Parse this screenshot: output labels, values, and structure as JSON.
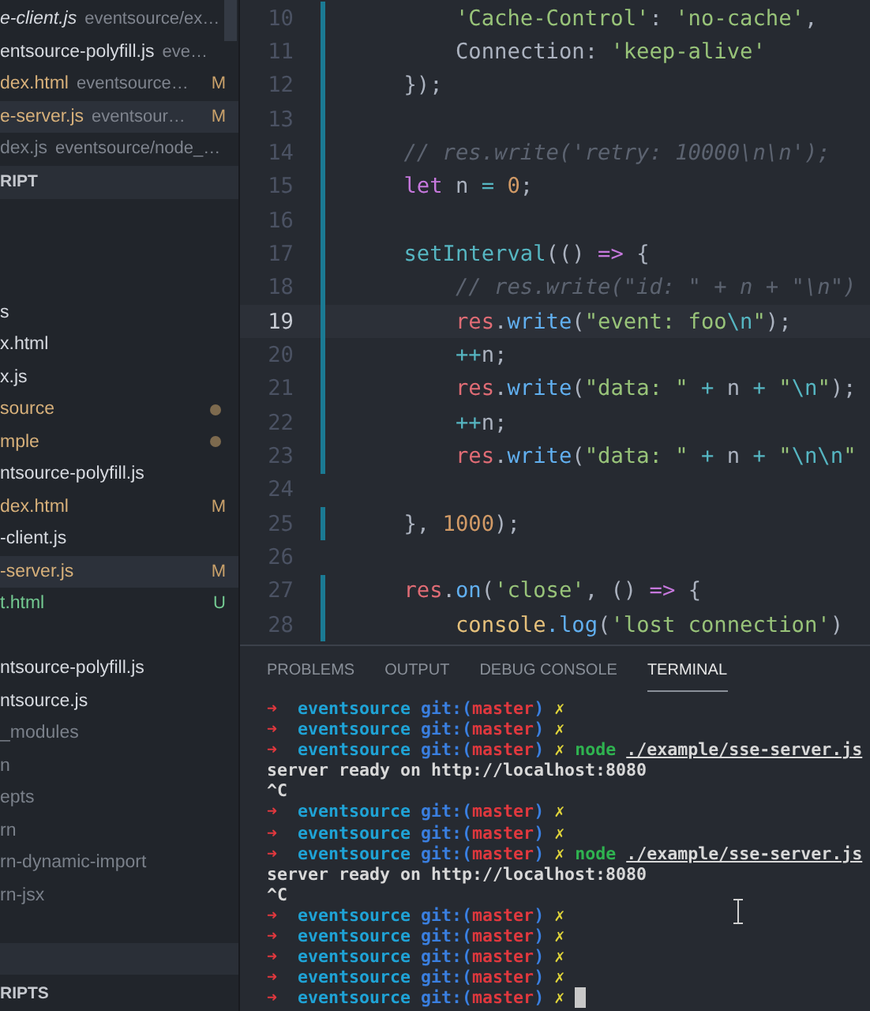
{
  "sidebar": {
    "open_editors": [
      {
        "name": "e-client.js",
        "path": "eventsource/ex…",
        "kind": "normal",
        "preview": true,
        "selected": false
      },
      {
        "name": "entsource-polyfill.js",
        "path": "eve…",
        "kind": "normal",
        "preview": false,
        "selected": false
      },
      {
        "name": "dex.html",
        "path": "eventsource…",
        "kind": "modified",
        "badge": "M",
        "preview": false,
        "selected": false
      },
      {
        "name": "e-server.js",
        "path": "eventsour…",
        "kind": "modified",
        "badge": "M",
        "preview": false,
        "selected": true
      },
      {
        "name": "dex.js",
        "path": "eventsource/node_…",
        "kind": "ignored",
        "preview": false,
        "selected": false
      }
    ],
    "section_header": "RIPT",
    "tree": [
      {
        "name": "s",
        "kind": "normal",
        "dot": false,
        "selected": false
      },
      {
        "name": "x.html",
        "kind": "normal",
        "dot": false,
        "selected": false
      },
      {
        "name": "x.js",
        "kind": "normal",
        "dot": false,
        "selected": false
      },
      {
        "name": "source",
        "kind": "modified",
        "dot": true,
        "selected": false
      },
      {
        "name": "mple",
        "kind": "modified",
        "dot": true,
        "selected": false
      },
      {
        "name": "ntsource-polyfill.js",
        "kind": "normal",
        "dot": false,
        "selected": false
      },
      {
        "name": "dex.html",
        "kind": "modified",
        "badge": "M",
        "dot": false,
        "selected": false
      },
      {
        "name": "-client.js",
        "kind": "normal",
        "dot": false,
        "selected": false
      },
      {
        "name": "-server.js",
        "kind": "modified",
        "badge": "M",
        "dot": false,
        "selected": true
      },
      {
        "name": "t.html",
        "kind": "untracked",
        "badge": "U",
        "dot": false,
        "selected": false
      }
    ],
    "tree_2": [
      {
        "name": "ntsource-polyfill.js",
        "kind": "normal",
        "dot": false,
        "selected": false
      },
      {
        "name": "ntsource.js",
        "kind": "normal",
        "dot": false,
        "selected": false
      },
      {
        "name": "_modules",
        "kind": "ignored",
        "dot": false,
        "selected": false
      },
      {
        "name": "n",
        "kind": "ignored",
        "dot": false,
        "selected": false
      },
      {
        "name": "epts",
        "kind": "ignored",
        "dot": false,
        "selected": false
      },
      {
        "name": "rn",
        "kind": "ignored",
        "dot": false,
        "selected": false
      },
      {
        "name": "rn-dynamic-import",
        "kind": "ignored",
        "dot": false,
        "selected": false
      },
      {
        "name": "rn-jsx",
        "kind": "ignored",
        "dot": false,
        "selected": false
      }
    ],
    "bottom_section_header": "RIPTS"
  },
  "editor": {
    "lines": [
      {
        "number": "10",
        "changed": true,
        "current": false,
        "tokens": [
          {
            "text": "        'Cache-Control'",
            "kind": "str"
          },
          {
            "text": ": ",
            "kind": "plain"
          },
          {
            "text": "'no-cache'",
            "kind": "str"
          },
          {
            "text": ",",
            "kind": "plain"
          }
        ]
      },
      {
        "number": "11",
        "changed": true,
        "current": false,
        "tokens": [
          {
            "text": "        Connection: ",
            "kind": "plain"
          },
          {
            "text": "'keep-alive'",
            "kind": "str"
          }
        ]
      },
      {
        "number": "12",
        "changed": true,
        "current": false,
        "tokens": [
          {
            "text": "    });",
            "kind": "plain"
          }
        ]
      },
      {
        "number": "13",
        "changed": true,
        "current": false
      },
      {
        "number": "14",
        "changed": true,
        "current": false,
        "tokens": [
          {
            "text": "    // res.write('retry: 10000\\n\\n');",
            "kind": "comment"
          }
        ]
      },
      {
        "number": "15",
        "changed": true,
        "current": false,
        "tokens": [
          {
            "text": "    let",
            "kind": "kw"
          },
          {
            "text": " n ",
            "kind": "plain"
          },
          {
            "text": "=",
            "kind": "op"
          },
          {
            "text": " 0",
            "kind": "num"
          },
          {
            "text": ";",
            "kind": "plain"
          }
        ]
      },
      {
        "number": "16",
        "changed": true,
        "current": false
      },
      {
        "number": "17",
        "changed": true,
        "current": false,
        "tokens": [
          {
            "text": "    setInterval",
            "kind": "call"
          },
          {
            "text": "(() ",
            "kind": "plain"
          },
          {
            "text": "=>",
            "kind": "kw"
          },
          {
            "text": " {",
            "kind": "plain"
          }
        ]
      },
      {
        "number": "18",
        "changed": true,
        "current": false,
        "tokens": [
          {
            "text": "        // res.write(\"id: \" + n + \"\\n\")",
            "kind": "comment"
          }
        ]
      },
      {
        "number": "19",
        "changed": true,
        "current": true,
        "tokens": [
          {
            "text": "        res",
            "kind": "var"
          },
          {
            "text": ".",
            "kind": "plain"
          },
          {
            "text": "write",
            "kind": "fn"
          },
          {
            "text": "(",
            "kind": "plain"
          },
          {
            "text": "\"event: foo",
            "kind": "str"
          },
          {
            "text": "\\n",
            "kind": "esc"
          },
          {
            "text": "\"",
            "kind": "str"
          },
          {
            "text": ");",
            "kind": "plain"
          }
        ]
      },
      {
        "number": "20",
        "changed": true,
        "current": false,
        "tokens": [
          {
            "text": "        ++",
            "kind": "op"
          },
          {
            "text": "n;",
            "kind": "plain"
          }
        ]
      },
      {
        "number": "21",
        "changed": true,
        "current": false,
        "tokens": [
          {
            "text": "        res",
            "kind": "var"
          },
          {
            "text": ".",
            "kind": "plain"
          },
          {
            "text": "write",
            "kind": "fn"
          },
          {
            "text": "(",
            "kind": "plain"
          },
          {
            "text": "\"data: \"",
            "kind": "str"
          },
          {
            "text": " + ",
            "kind": "op"
          },
          {
            "text": "n",
            "kind": "plain"
          },
          {
            "text": " + ",
            "kind": "op"
          },
          {
            "text": "\"",
            "kind": "str"
          },
          {
            "text": "\\n",
            "kind": "esc"
          },
          {
            "text": "\"",
            "kind": "str"
          },
          {
            "text": ");",
            "kind": "plain"
          }
        ]
      },
      {
        "number": "22",
        "changed": true,
        "current": false,
        "tokens": [
          {
            "text": "        ++",
            "kind": "op"
          },
          {
            "text": "n;",
            "kind": "plain"
          }
        ]
      },
      {
        "number": "23",
        "changed": true,
        "current": false,
        "tokens": [
          {
            "text": "        res",
            "kind": "var"
          },
          {
            "text": ".",
            "kind": "plain"
          },
          {
            "text": "write",
            "kind": "fn"
          },
          {
            "text": "(",
            "kind": "plain"
          },
          {
            "text": "\"data: \"",
            "kind": "str"
          },
          {
            "text": " + ",
            "kind": "op"
          },
          {
            "text": "n",
            "kind": "plain"
          },
          {
            "text": " + ",
            "kind": "op"
          },
          {
            "text": "\"",
            "kind": "str"
          },
          {
            "text": "\\n\\n",
            "kind": "esc"
          },
          {
            "text": "\"",
            "kind": "str"
          }
        ]
      },
      {
        "number": "24",
        "changed": false,
        "current": false
      },
      {
        "number": "25",
        "changed": true,
        "current": false,
        "tokens": [
          {
            "text": "    }, ",
            "kind": "plain"
          },
          {
            "text": "1000",
            "kind": "num"
          },
          {
            "text": ");",
            "kind": "plain"
          }
        ]
      },
      {
        "number": "26",
        "changed": false,
        "current": false
      },
      {
        "number": "27",
        "changed": true,
        "current": false,
        "tokens": [
          {
            "text": "    res",
            "kind": "var"
          },
          {
            "text": ".",
            "kind": "plain"
          },
          {
            "text": "on",
            "kind": "fn"
          },
          {
            "text": "(",
            "kind": "plain"
          },
          {
            "text": "'close'",
            "kind": "str"
          },
          {
            "text": ", () ",
            "kind": "plain"
          },
          {
            "text": "=>",
            "kind": "kw"
          },
          {
            "text": " {",
            "kind": "plain"
          }
        ]
      },
      {
        "number": "28",
        "changed": true,
        "current": false,
        "tokens": [
          {
            "text": "        console",
            "kind": "class"
          },
          {
            "text": ".log",
            "kind": "fn"
          },
          {
            "text": "(",
            "kind": "plain"
          },
          {
            "text": "'lost connection'",
            "kind": "str"
          },
          {
            "text": ")",
            "kind": "plain"
          }
        ]
      }
    ]
  },
  "panel": {
    "tabs": [
      {
        "label": "PROBLEMS",
        "selected": false
      },
      {
        "label": "OUTPUT",
        "selected": false
      },
      {
        "label": "DEBUG CONSOLE",
        "selected": false
      },
      {
        "label": "TERMINAL",
        "selected": true
      }
    ],
    "terminal": [
      {
        "cursor": false,
        "segments": [
          {
            "text": "➜",
            "kind": "arrow"
          },
          {
            "text": "  eventsource",
            "kind": "dir"
          },
          {
            "text": " git:(",
            "kind": "git"
          },
          {
            "text": "master",
            "kind": "branch"
          },
          {
            "text": ")",
            "kind": "git"
          },
          {
            "text": " ✗",
            "kind": "dirty"
          }
        ]
      },
      {
        "cursor": false,
        "segments": [
          {
            "text": "➜",
            "kind": "arrow"
          },
          {
            "text": "  eventsource",
            "kind": "dir"
          },
          {
            "text": " git:(",
            "kind": "git"
          },
          {
            "text": "master",
            "kind": "branch"
          },
          {
            "text": ")",
            "kind": "git"
          },
          {
            "text": " ✗",
            "kind": "dirty"
          }
        ]
      },
      {
        "cursor": false,
        "segments": [
          {
            "text": "➜",
            "kind": "arrow"
          },
          {
            "text": "  eventsource",
            "kind": "dir"
          },
          {
            "text": " git:(",
            "kind": "git"
          },
          {
            "text": "master",
            "kind": "branch"
          },
          {
            "text": ")",
            "kind": "git"
          },
          {
            "text": " ✗",
            "kind": "dirty"
          },
          {
            "text": " node ",
            "kind": "cmd"
          },
          {
            "text": "./example/sse-server.js",
            "kind": "arg"
          }
        ]
      },
      {
        "cursor": false,
        "segments": [
          {
            "text": "server ready on http://localhost:8080",
            "kind": "out"
          }
        ]
      },
      {
        "cursor": false,
        "segments": [
          {
            "text": "^C",
            "kind": "out"
          }
        ]
      },
      {
        "cursor": false,
        "segments": [
          {
            "text": "➜",
            "kind": "arrow"
          },
          {
            "text": "  eventsource",
            "kind": "dir"
          },
          {
            "text": " git:(",
            "kind": "git"
          },
          {
            "text": "master",
            "kind": "branch"
          },
          {
            "text": ")",
            "kind": "git"
          },
          {
            "text": " ✗",
            "kind": "dirty"
          }
        ]
      },
      {
        "cursor": false,
        "segments": [
          {
            "text": "➜",
            "kind": "arrow"
          },
          {
            "text": "  eventsource",
            "kind": "dir"
          },
          {
            "text": " git:(",
            "kind": "git"
          },
          {
            "text": "master",
            "kind": "branch"
          },
          {
            "text": ")",
            "kind": "git"
          },
          {
            "text": " ✗",
            "kind": "dirty"
          }
        ]
      },
      {
        "cursor": false,
        "segments": [
          {
            "text": "➜",
            "kind": "arrow"
          },
          {
            "text": "  eventsource",
            "kind": "dir"
          },
          {
            "text": " git:(",
            "kind": "git"
          },
          {
            "text": "master",
            "kind": "branch"
          },
          {
            "text": ")",
            "kind": "git"
          },
          {
            "text": " ✗",
            "kind": "dirty"
          },
          {
            "text": " node ",
            "kind": "cmd"
          },
          {
            "text": "./example/sse-server.js",
            "kind": "arg"
          }
        ]
      },
      {
        "cursor": false,
        "segments": [
          {
            "text": "server ready on http://localhost:8080",
            "kind": "out"
          }
        ]
      },
      {
        "cursor": false,
        "segments": [
          {
            "text": "^C",
            "kind": "out"
          }
        ]
      },
      {
        "cursor": false,
        "segments": [
          {
            "text": "➜",
            "kind": "arrow"
          },
          {
            "text": "  eventsource",
            "kind": "dir"
          },
          {
            "text": " git:(",
            "kind": "git"
          },
          {
            "text": "master",
            "kind": "branch"
          },
          {
            "text": ")",
            "kind": "git"
          },
          {
            "text": " ✗",
            "kind": "dirty"
          }
        ]
      },
      {
        "cursor": false,
        "segments": [
          {
            "text": "➜",
            "kind": "arrow"
          },
          {
            "text": "  eventsource",
            "kind": "dir"
          },
          {
            "text": " git:(",
            "kind": "git"
          },
          {
            "text": "master",
            "kind": "branch"
          },
          {
            "text": ")",
            "kind": "git"
          },
          {
            "text": " ✗",
            "kind": "dirty"
          }
        ]
      },
      {
        "cursor": false,
        "segments": [
          {
            "text": "➜",
            "kind": "arrow"
          },
          {
            "text": "  eventsource",
            "kind": "dir"
          },
          {
            "text": " git:(",
            "kind": "git"
          },
          {
            "text": "master",
            "kind": "branch"
          },
          {
            "text": ")",
            "kind": "git"
          },
          {
            "text": " ✗",
            "kind": "dirty"
          }
        ]
      },
      {
        "cursor": false,
        "segments": [
          {
            "text": "➜",
            "kind": "arrow"
          },
          {
            "text": "  eventsource",
            "kind": "dir"
          },
          {
            "text": " git:(",
            "kind": "git"
          },
          {
            "text": "master",
            "kind": "branch"
          },
          {
            "text": ")",
            "kind": "git"
          },
          {
            "text": " ✗",
            "kind": "dirty"
          }
        ]
      },
      {
        "cursor": true,
        "segments": [
          {
            "text": "➜",
            "kind": "arrow"
          },
          {
            "text": "  eventsource",
            "kind": "dir"
          },
          {
            "text": " git:(",
            "kind": "git"
          },
          {
            "text": "master",
            "kind": "branch"
          },
          {
            "text": ")",
            "kind": "git"
          },
          {
            "text": " ✗",
            "kind": "dirty"
          }
        ]
      }
    ]
  }
}
